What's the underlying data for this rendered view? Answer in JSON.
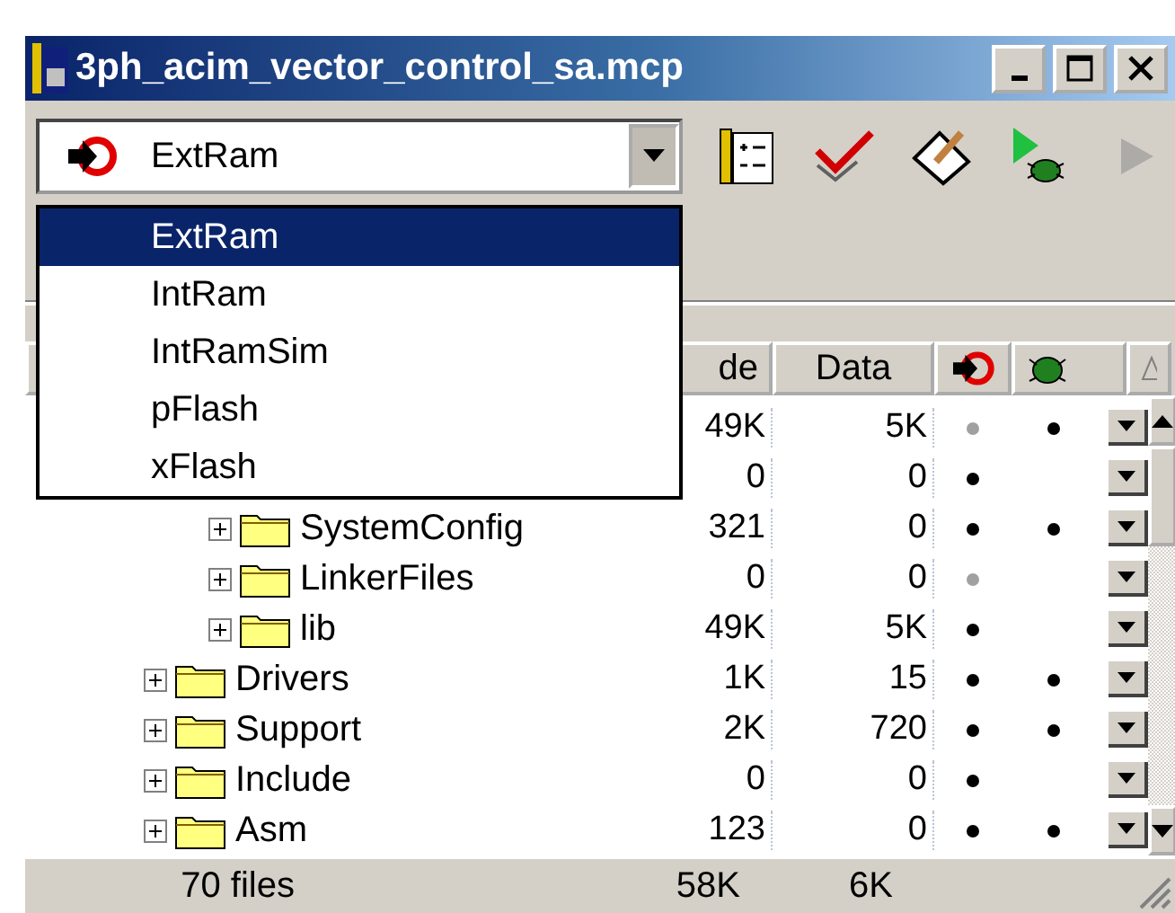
{
  "window": {
    "title": "3ph_acim_vector_control_sa.mcp"
  },
  "toolbar": {
    "build_config": {
      "value": "ExtRam",
      "expanded": true,
      "options": [
        {
          "label": "ExtRam",
          "selected": true
        },
        {
          "label": "IntRam",
          "selected": false
        },
        {
          "label": "IntRamSim",
          "selected": false
        },
        {
          "label": "pFlash",
          "selected": false
        },
        {
          "label": "xFlash",
          "selected": false
        }
      ]
    },
    "buttons": [
      {
        "kind": "options",
        "disabled": false
      },
      {
        "kind": "check",
        "disabled": false
      },
      {
        "kind": "edit",
        "disabled": false
      },
      {
        "kind": "debug",
        "disabled": false
      },
      {
        "kind": "run",
        "disabled": true
      }
    ]
  },
  "table": {
    "columns": [
      {
        "label": "de"
      },
      {
        "label": "Data"
      }
    ],
    "rows": [
      {
        "code": "49K",
        "data": "5K",
        "build_dot": {
          "color": "#a0a0a0"
        },
        "debug_dot": {
          "color": "#000000"
        },
        "children": [
          {
            "code": "0",
            "data": "0",
            "build_dot": {
              "color": "#000000"
            },
            "children": [
              {
                "name": "SystemConfig",
                "code": "321",
                "data": "0",
                "build_dot": {
                  "color": "#000000"
                },
                "debug_dot": {
                  "color": "#000000"
                }
              },
              {
                "name": "LinkerFiles",
                "code": "0",
                "data": "0",
                "build_dot": {
                  "color": "#a0a0a0"
                }
              },
              {
                "name": "lib",
                "code": "49K",
                "data": "5K",
                "build_dot": {
                  "color": "#000000"
                }
              }
            ]
          },
          {
            "name": "Drivers",
            "code": "1K",
            "data": "15",
            "build_dot": {
              "color": "#000000"
            },
            "debug_dot": {
              "color": "#000000"
            }
          },
          {
            "name": "Support",
            "code": "2K",
            "data": "720",
            "build_dot": {
              "color": "#000000"
            },
            "debug_dot": {
              "color": "#000000"
            }
          },
          {
            "name": "Include",
            "code": "0",
            "data": "0",
            "build_dot": {
              "color": "#000000"
            }
          },
          {
            "name": "Asm",
            "code": "123",
            "data": "0",
            "build_dot": {
              "color": "#000000"
            },
            "debug_dot": {
              "color": "#000000"
            }
          }
        ]
      }
    ]
  },
  "status_bar": {
    "files": "70 files",
    "code": "58K",
    "data": "6K"
  }
}
